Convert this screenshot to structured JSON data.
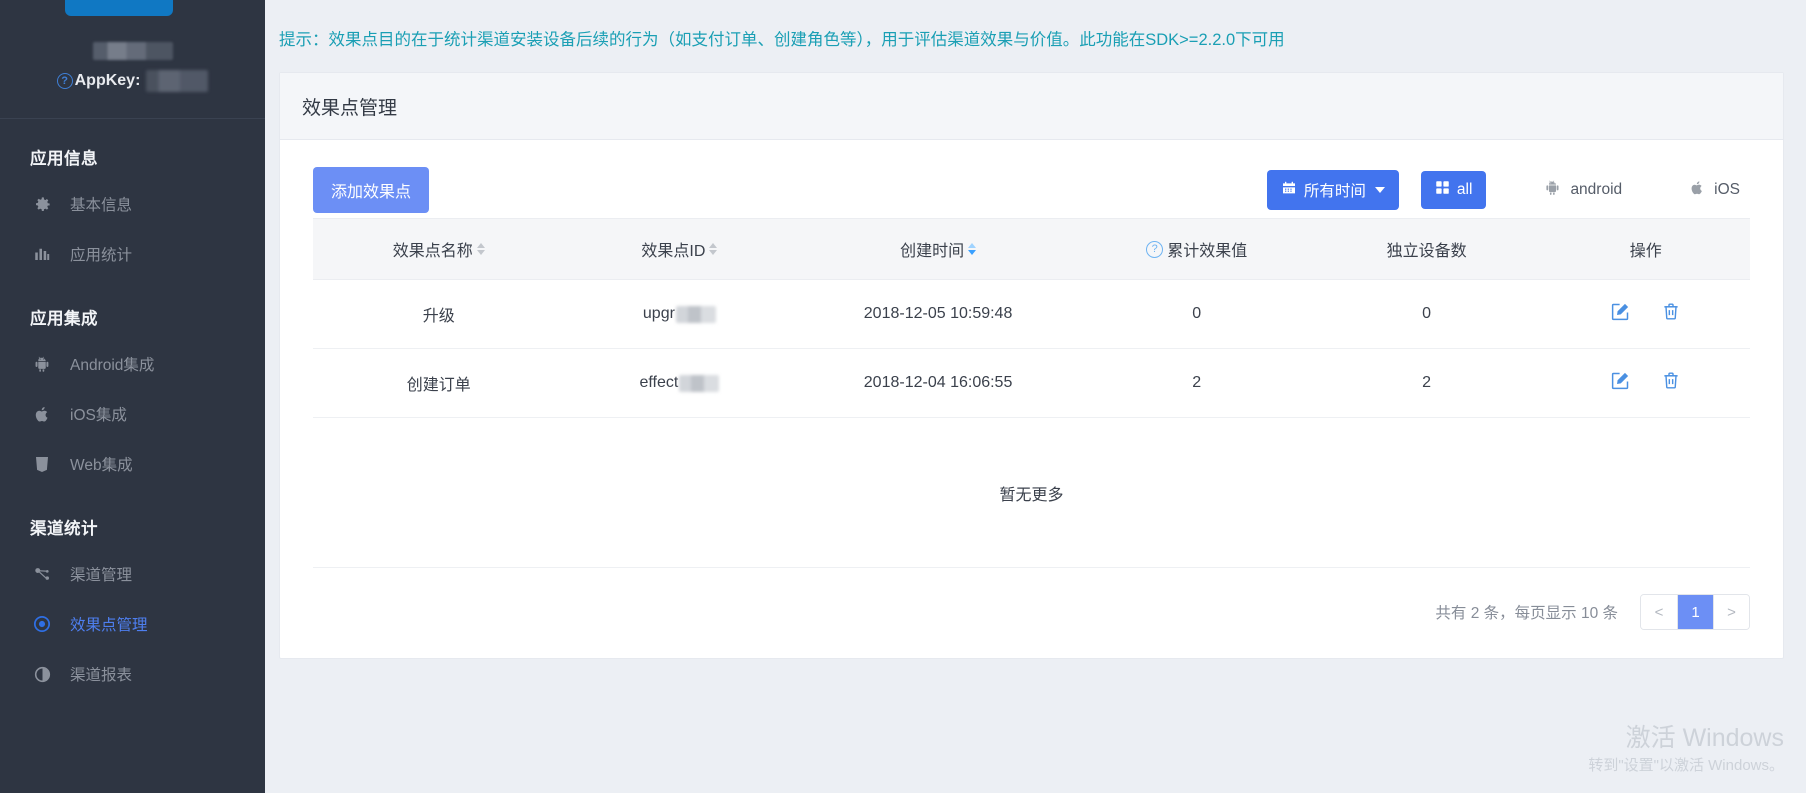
{
  "sidebar": {
    "appkey_label": "AppKey:",
    "groups": [
      {
        "title": "应用信息",
        "items": [
          {
            "label": "基本信息",
            "icon": "gear-icon",
            "active": false
          },
          {
            "label": "应用统计",
            "icon": "bar-chart-icon",
            "active": false
          }
        ]
      },
      {
        "title": "应用集成",
        "items": [
          {
            "label": "Android集成",
            "icon": "android-icon",
            "active": false
          },
          {
            "label": "iOS集成",
            "icon": "apple-icon",
            "active": false
          },
          {
            "label": "Web集成",
            "icon": "html5-icon",
            "active": false
          }
        ]
      },
      {
        "title": "渠道统计",
        "items": [
          {
            "label": "渠道管理",
            "icon": "channel-icon",
            "active": false
          },
          {
            "label": "效果点管理",
            "icon": "target-icon",
            "active": true
          },
          {
            "label": "渠道报表",
            "icon": "contrast-icon",
            "active": false
          }
        ]
      }
    ]
  },
  "notice": {
    "text": "提示：效果点目的在于统计渠道安装设备后续的行为（如支付订单、创建角色等），用于评估渠道效果与价值。此功能在SDK>=2.2.0下可用",
    "color": "#1a9fb4"
  },
  "card": {
    "title": "效果点管理"
  },
  "toolbar": {
    "add_label": "添加效果点",
    "time_filter_label": "所有时间",
    "all_label": "all",
    "android_label": "android",
    "ios_label": "iOS",
    "primary_color": "#6c8ff5",
    "accent_color": "#4274ee"
  },
  "table": {
    "columns": [
      {
        "label": "效果点名称",
        "sortable": true,
        "sorted": "none",
        "help": false
      },
      {
        "label": "效果点ID",
        "sortable": true,
        "sorted": "none",
        "help": false
      },
      {
        "label": "创建时间",
        "sortable": true,
        "sorted": "desc",
        "help": false
      },
      {
        "label": "累计效果值",
        "sortable": false,
        "sorted": "none",
        "help": true
      },
      {
        "label": "独立设备数",
        "sortable": false,
        "sorted": "none",
        "help": false
      },
      {
        "label": "操作",
        "sortable": false,
        "sorted": "none",
        "help": false
      }
    ],
    "rows": [
      {
        "name": "升级",
        "id_prefix": "upgr",
        "created": "2018-12-05 10:59:48",
        "effect_value": "0",
        "unique_devices": "0"
      },
      {
        "name": "创建订单",
        "id_prefix": "effect",
        "created": "2018-12-04 16:06:55",
        "effect_value": "2",
        "unique_devices": "2"
      }
    ],
    "empty_more": "暂无更多",
    "row_actions": {
      "edit": "edit-icon",
      "delete": "delete-icon"
    }
  },
  "pagination": {
    "summary": "共有 2 条，每页显示 10 条",
    "prev": "<",
    "next": ">",
    "pages": [
      "1"
    ],
    "current": "1"
  },
  "watermark": {
    "line1": "激活 Windows",
    "line2": "转到\"设置\"以激活 Windows。"
  }
}
